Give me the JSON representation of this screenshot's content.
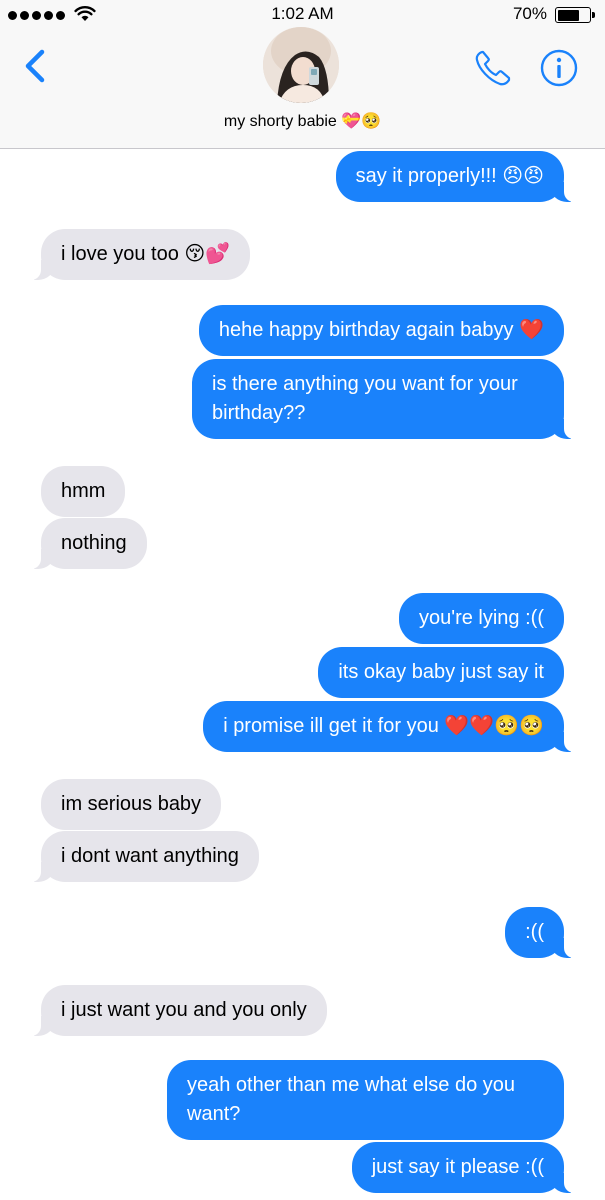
{
  "status_bar": {
    "time": "1:02 AM",
    "battery_percent": "70%",
    "battery_level": 0.7,
    "signal_bars": 5
  },
  "header": {
    "contact_name": "my shorty babie 💝🥺",
    "back_icon": "chevron-left-icon",
    "call_icon": "phone-icon",
    "info_icon": "info-icon"
  },
  "colors": {
    "accent": "#1a82fb",
    "sent_bubble": "#1a82fb",
    "received_bubble": "#e6e5eb"
  },
  "messages": [
    {
      "from": "me",
      "text": "say it properly!!! 😠😠"
    },
    {
      "from": "them",
      "text": "i love you too 😚💕"
    },
    {
      "from": "me",
      "text": "hehe happy birthday again babyy ❤️"
    },
    {
      "from": "me",
      "text": "is there anything you want for your birthday??"
    },
    {
      "from": "them",
      "text": "hmm"
    },
    {
      "from": "them",
      "text": "nothing"
    },
    {
      "from": "me",
      "text": "you're lying :(("
    },
    {
      "from": "me",
      "text": "its okay baby just say it"
    },
    {
      "from": "me",
      "text": "i promise ill get it for you ❤️❤️🥺🥺"
    },
    {
      "from": "them",
      "text": "im serious baby"
    },
    {
      "from": "them",
      "text": "i dont want anything"
    },
    {
      "from": "me",
      "text": ":(("
    },
    {
      "from": "them",
      "text": "i just want you and you only"
    },
    {
      "from": "me",
      "text": "yeah other than me what else do you want?"
    },
    {
      "from": "me",
      "text": "just say it please :(("
    }
  ]
}
